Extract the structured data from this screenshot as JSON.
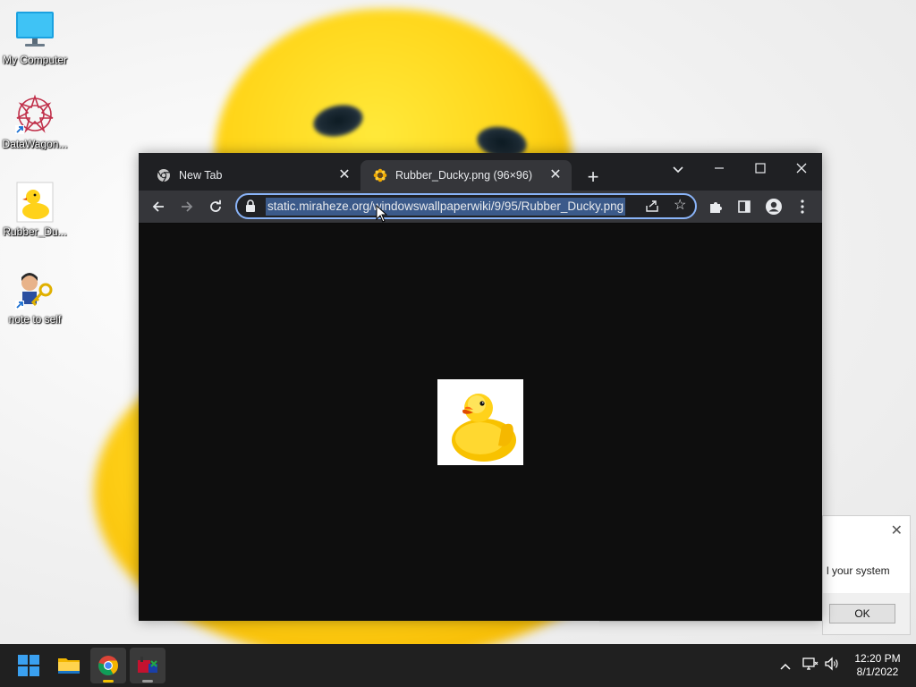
{
  "desktop": {
    "icons": [
      {
        "label": "My Computer",
        "icon": "monitor-icon"
      },
      {
        "label": "DataWagon...",
        "icon": "datawagon-icon"
      },
      {
        "label": "Rubber_Du...",
        "icon": "rubber-duck-file-icon"
      },
      {
        "label": "note to self",
        "icon": "note-to-self-icon"
      }
    ]
  },
  "browser": {
    "tabs": [
      {
        "title": "New Tab",
        "icon": "chrome-icon",
        "active": false
      },
      {
        "title": "Rubber_Ducky.png (96×96)",
        "icon": "flower-favicon-icon",
        "active": true
      }
    ],
    "url": "static.miraheze.org/windowswallpaperwiki/9/95/Rubber_Ducky.png",
    "omnibox_selected": true,
    "image": {
      "name": "Rubber_Ducky.png",
      "width": 96,
      "height": 96
    }
  },
  "dialog": {
    "message_fragment": "l your system",
    "ok_label": "OK"
  },
  "taskbar": {
    "apps": [
      {
        "name": "start-button",
        "icon": "windows-logo-icon"
      },
      {
        "name": "file-explorer",
        "icon": "folder-icon"
      },
      {
        "name": "chrome",
        "icon": "chrome-icon",
        "active": true
      },
      {
        "name": "app-window",
        "icon": "app-icon"
      }
    ],
    "time": "12:20 PM",
    "date": "8/1/2022"
  },
  "colors": {
    "accent": "#8ab4f8",
    "tab_active": "#35363a",
    "tabstrip": "#1f2023",
    "taskbar": "#202020",
    "duck_yellow": "#ffd21a"
  }
}
